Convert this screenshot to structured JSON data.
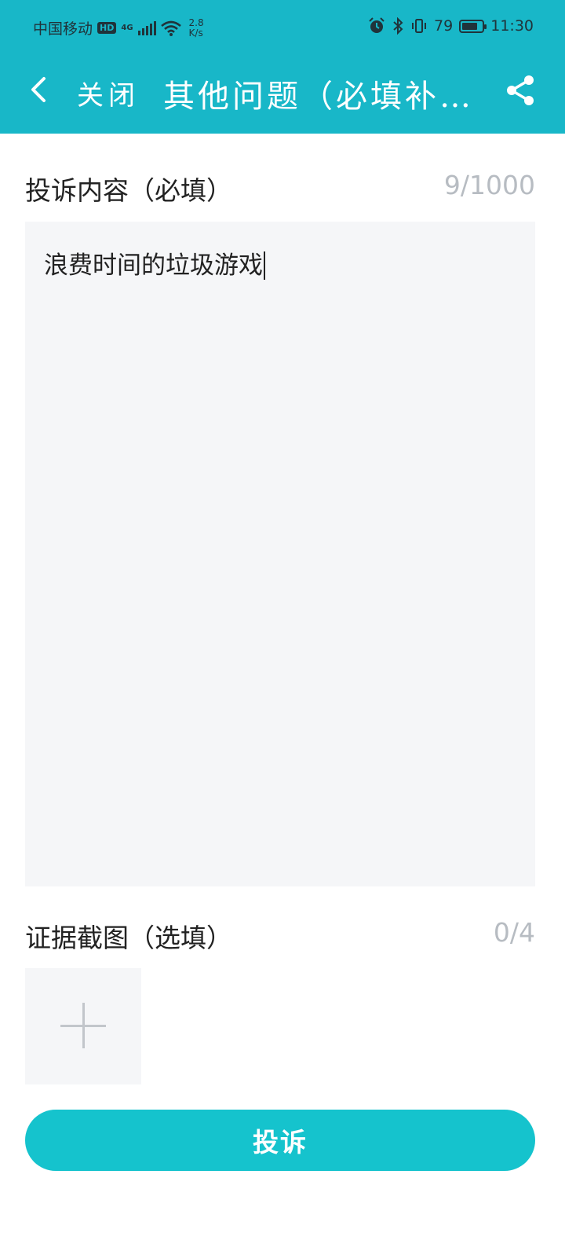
{
  "status_bar": {
    "carrier": "中国移动",
    "hd_badge": "HD",
    "network": "4G",
    "speed_value": "2.8",
    "speed_unit": "K/s",
    "battery_percent": 79,
    "battery_text": "79",
    "time": "11:30"
  },
  "app_bar": {
    "back_icon": "chevron-left-icon",
    "close_label": "关闭",
    "title": "其他问题（必填补充说明）",
    "share_icon": "share-icon",
    "background_color": "#18b7c8"
  },
  "complaint": {
    "label": "投诉内容（必填）",
    "counter": "9/1000",
    "content": "浪费时间的垃圾游戏"
  },
  "evidence": {
    "label": "证据截图（选填）",
    "counter": "0/4",
    "add_icon": "plus-icon"
  },
  "submit": {
    "label": "投诉",
    "color": "#15c3cd"
  }
}
